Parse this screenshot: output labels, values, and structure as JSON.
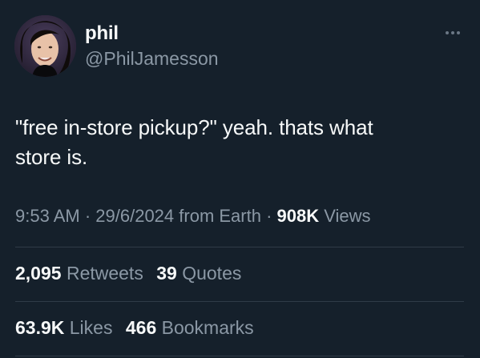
{
  "user": {
    "display_name": "phil",
    "handle": "@PhilJamesson"
  },
  "tweet": {
    "text_line1": "\"free in-store pickup?\" yeah. thats what",
    "text_line2": "store is."
  },
  "meta": {
    "time": "9:53 AM",
    "sep1": " · ",
    "date": "29/6/2024",
    "source": " from Earth",
    "sep2": " · ",
    "views_count": "908K",
    "views_label": " Views"
  },
  "stats": {
    "retweets_count": "2,095",
    "retweets_label": " Retweets",
    "quotes_count": "39",
    "quotes_label": " Quotes",
    "likes_count": "63.9K",
    "likes_label": " Likes",
    "bookmarks_count": "466",
    "bookmarks_label": " Bookmarks"
  },
  "colors": {
    "background": "#15202b",
    "primary_text": "#f7f9f9",
    "secondary_text": "#8b98a5",
    "divider": "#2f3b47"
  },
  "icons": {
    "more": "more-horizontal-icon"
  }
}
